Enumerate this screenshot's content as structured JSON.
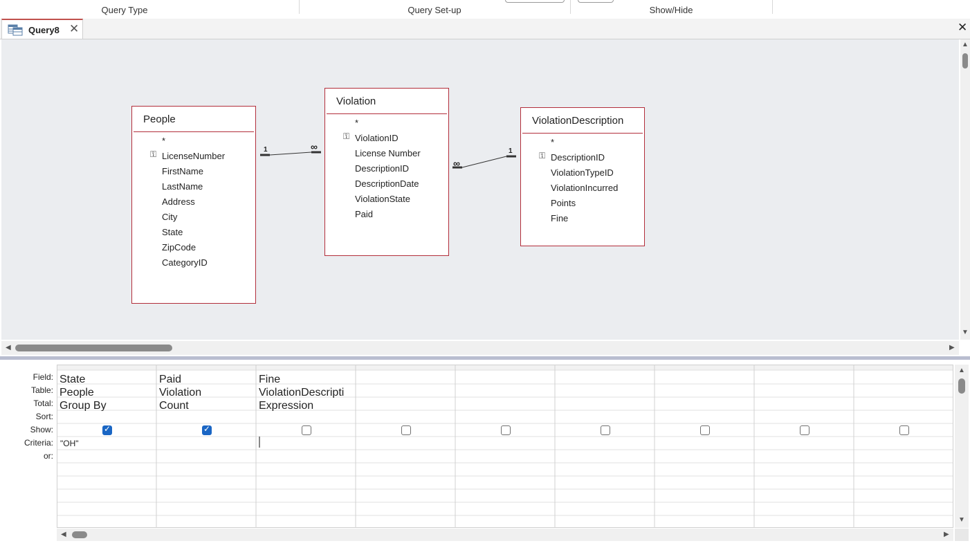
{
  "ribbon": {
    "groups": [
      "Query Type",
      "Query Set-up",
      "Show/Hide"
    ]
  },
  "tab": {
    "title": "Query8"
  },
  "tables": [
    {
      "name": "People",
      "fields": [
        "*",
        "LicenseNumber",
        "FirstName",
        "LastName",
        "Address",
        "City",
        "State",
        "ZipCode",
        "CategoryID"
      ],
      "key_field": "LicenseNumber"
    },
    {
      "name": "Violation",
      "fields": [
        "*",
        "ViolationID",
        "License Number",
        "DescriptionID",
        "DescriptionDate",
        "ViolationState",
        "Paid"
      ],
      "key_field": "ViolationID"
    },
    {
      "name": "ViolationDescription",
      "fields": [
        "*",
        "DescriptionID",
        "ViolationTypeID",
        "ViolationIncurred",
        "Points",
        "Fine"
      ],
      "key_field": "DescriptionID"
    }
  ],
  "relationships": [
    {
      "from": "People",
      "to": "Violation",
      "from_label": "1",
      "to_label": "∞"
    },
    {
      "from": "Violation",
      "to": "ViolationDescription",
      "from_label": "∞",
      "to_label": "1"
    }
  ],
  "grid": {
    "row_labels": [
      "Field:",
      "Table:",
      "Total:",
      "Sort:",
      "Show:",
      "Criteria:",
      "or:"
    ],
    "columns": [
      {
        "field": "State",
        "table": "People",
        "total": "Group By",
        "sort": "",
        "show": true,
        "criteria": "\"OH\""
      },
      {
        "field": "Paid",
        "table": "Violation",
        "total": "Count",
        "sort": "",
        "show": true,
        "criteria": ""
      },
      {
        "field": "Fine",
        "table": "ViolationDescripti",
        "total": "Expression",
        "sort": "",
        "show": false,
        "criteria": ""
      },
      {
        "field": "",
        "table": "",
        "total": "",
        "sort": "",
        "show": false,
        "criteria": ""
      },
      {
        "field": "",
        "table": "",
        "total": "",
        "sort": "",
        "show": false,
        "criteria": ""
      },
      {
        "field": "",
        "table": "",
        "total": "",
        "sort": "",
        "show": false,
        "criteria": ""
      },
      {
        "field": "",
        "table": "",
        "total": "",
        "sort": "",
        "show": false,
        "criteria": ""
      },
      {
        "field": "",
        "table": "",
        "total": "",
        "sort": "",
        "show": false,
        "criteria": ""
      },
      {
        "field": "",
        "table": "",
        "total": "",
        "sort": "",
        "show": false,
        "criteria": ""
      }
    ]
  },
  "icons": {
    "tab_icon": "query-icon",
    "close": "close-icon",
    "key": "key-icon"
  }
}
